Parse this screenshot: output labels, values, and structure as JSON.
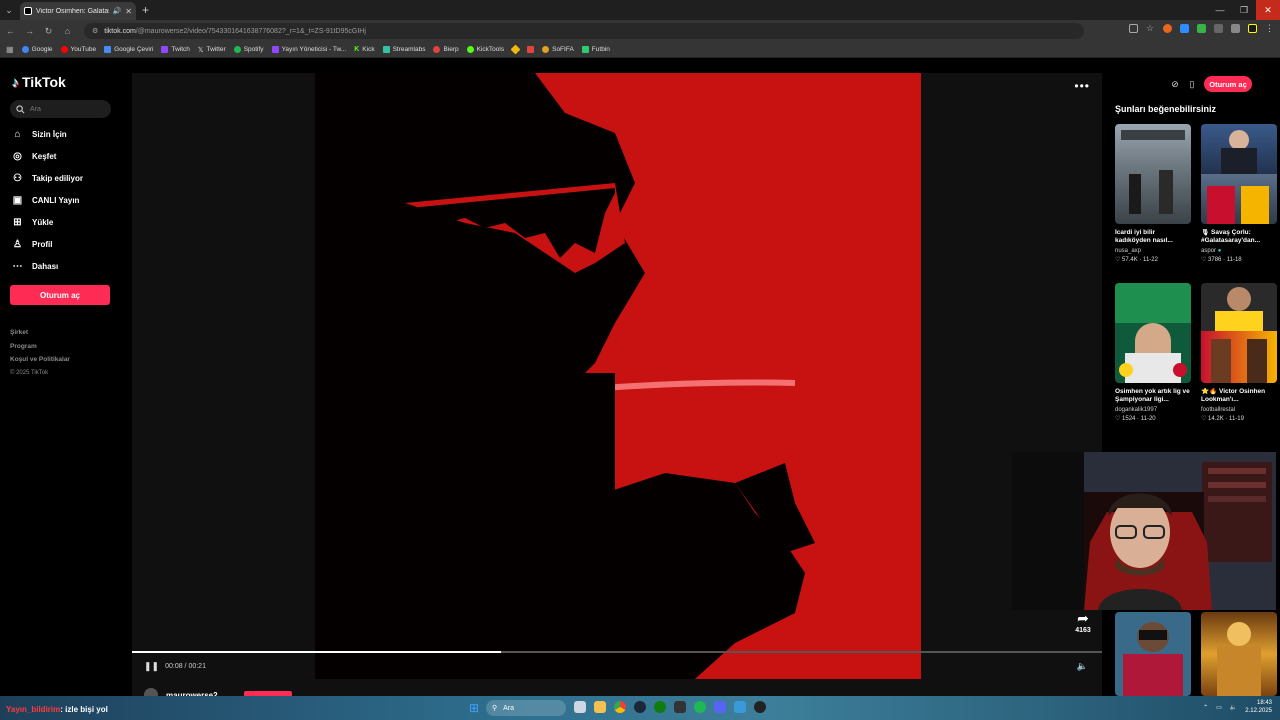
{
  "browser": {
    "tab_title": "Victor Osimhen: Galatasaray",
    "url_host": "tiktok.com",
    "url_path": "/@maurowerse2/video/7543301641638776082?_r=1&_t=ZS-91tD95cGIHj",
    "bookmarks": [
      {
        "label": "Google",
        "color": "#4285f4"
      },
      {
        "label": "YouTube",
        "color": "#ff0000"
      },
      {
        "label": "Google Çeviri",
        "color": "#4a8af4"
      },
      {
        "label": "Twitch",
        "color": "#9146ff"
      },
      {
        "label": "Twitter",
        "color": "#1d9bf0"
      },
      {
        "label": "Spotify",
        "color": "#1db954"
      },
      {
        "label": "Yayın Yöneticisi - Tw...",
        "color": "#9146ff"
      },
      {
        "label": "Kick",
        "color": "#53fc18"
      },
      {
        "label": "Streamlabs",
        "color": "#31c3a2"
      },
      {
        "label": "Bierp",
        "color": "#e0443d"
      },
      {
        "label": "KickTools",
        "color": "#53fc18"
      },
      {
        "label": "",
        "color": "#f0b90b"
      },
      {
        "label": "",
        "color": "#e0443d"
      },
      {
        "label": "SoFIFA",
        "color": "#e0a020"
      },
      {
        "label": "Futbin",
        "color": "#2ecc71"
      }
    ]
  },
  "sidebar": {
    "brand": "TikTok",
    "search_placeholder": "Ara",
    "items": [
      {
        "label": "Sizin İçin",
        "icon": "home-icon"
      },
      {
        "label": "Keşfet",
        "icon": "compass-icon"
      },
      {
        "label": "Takip ediliyor",
        "icon": "user-follow-icon"
      },
      {
        "label": "CANLI Yayın",
        "icon": "live-icon"
      },
      {
        "label": "Yükle",
        "icon": "upload-icon"
      },
      {
        "label": "Profil",
        "icon": "profile-icon"
      },
      {
        "label": "Dahası",
        "icon": "more-icon"
      }
    ],
    "login_label": "Oturum aç",
    "footer": [
      "Şirket",
      "Program",
      "Koşul ve Politikalar"
    ],
    "copyright": "© 2025 TikTok"
  },
  "player": {
    "time": "00:08 / 00:21",
    "progress": 0.38,
    "author": "maurowerse2",
    "share_count": "4163"
  },
  "header": {
    "login_label": "Oturum aç"
  },
  "recommendations": {
    "title": "Şunları beğenebilirsiniz",
    "cards": [
      {
        "title": "İcardi iyi bilir kadıköyden nasıl...",
        "author": "nusa_axp",
        "stats": "57.4K · 11-22"
      },
      {
        "title": "🎙 Savaş Çorlu: #Galatasaray'dan...",
        "author": "aspor",
        "stats": "3786 · 11-18"
      },
      {
        "title": "Osimhen yok artık lig ve Şampiyonar ligi...",
        "author": "dogankalik1997",
        "stats": "1524 · 11-20"
      },
      {
        "title": "⭐🔥 Victor Osinhen Lookman'ı...",
        "author": "footballrestal",
        "stats": "14.2K · 11-19"
      }
    ]
  },
  "stream_overlay": {
    "chat_user": "Yayın_bildirim",
    "chat_text": ": izle bişi yol"
  },
  "taskbar": {
    "search_placeholder": "Ara",
    "time": "18:43",
    "date": "2.12.2025"
  }
}
